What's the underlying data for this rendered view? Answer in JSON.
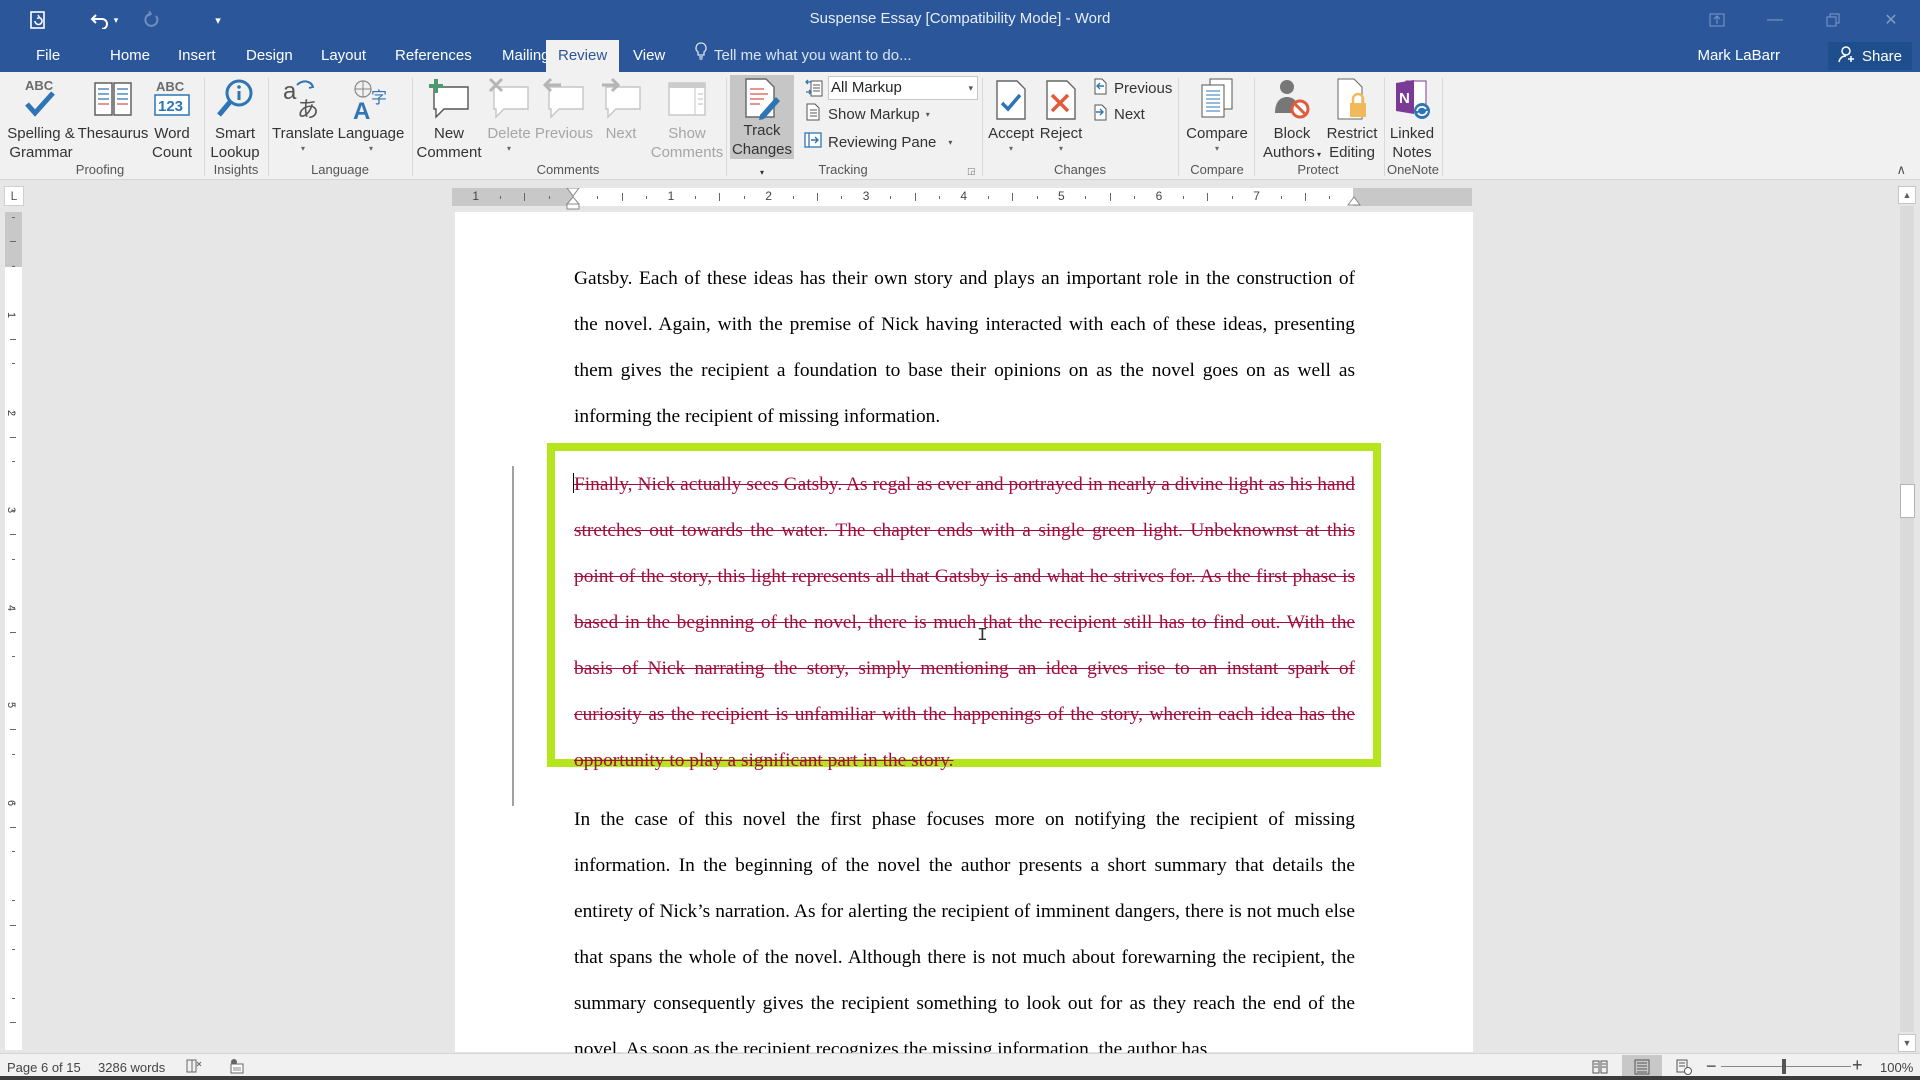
{
  "window": {
    "title": "Suspense Essay [Compatibility Mode] - Word",
    "controls": [
      "ribbon-display-options",
      "minimize",
      "restore",
      "close"
    ]
  },
  "quick_access": {
    "items": [
      {
        "name": "autosave-icon",
        "glyph": "⟳"
      },
      {
        "name": "undo-icon",
        "glyph": "↶"
      },
      {
        "name": "redo-icon",
        "glyph": "↻"
      },
      {
        "name": "customize-qat-icon",
        "glyph": "▾"
      }
    ]
  },
  "tabs": [
    {
      "label": "File",
      "active": false
    },
    {
      "label": "Home",
      "active": false
    },
    {
      "label": "Insert",
      "active": false
    },
    {
      "label": "Design",
      "active": false
    },
    {
      "label": "Layout",
      "active": false
    },
    {
      "label": "References",
      "active": false
    },
    {
      "label": "Mailings",
      "active": false
    },
    {
      "label": "Review",
      "active": true
    },
    {
      "label": "View",
      "active": false
    }
  ],
  "tell_me": {
    "placeholder": "Tell me what you want to do..."
  },
  "user": {
    "name": "Mark LaBarr"
  },
  "share": {
    "label": "Share"
  },
  "ribbon": {
    "groups": {
      "proofing": "Proofing",
      "insights": "Insights",
      "language": "Language",
      "comments": "Comments",
      "tracking": "Tracking",
      "changes": "Changes",
      "compare": "Compare",
      "protect": "Protect",
      "onenote": "OneNote"
    },
    "buttons": {
      "spelling": {
        "line1": "Spelling &",
        "line2": "Grammar"
      },
      "thesaurus": {
        "line1": "Thesaurus",
        "line2": ""
      },
      "word_count": {
        "line1": "Word",
        "line2": "Count"
      },
      "smart_lookup": {
        "line1": "Smart",
        "line2": "Lookup"
      },
      "translate": {
        "line1": "Translate",
        "line2": ""
      },
      "language": {
        "line1": "Language",
        "line2": ""
      },
      "new_comment": {
        "line1": "New",
        "line2": "Comment"
      },
      "delete": {
        "line1": "Delete",
        "line2": ""
      },
      "previous_comment": {
        "line1": "Previous",
        "line2": ""
      },
      "next_comment": {
        "line1": "Next",
        "line2": ""
      },
      "show_comments": {
        "line1": "Show",
        "line2": "Comments"
      },
      "track_changes": {
        "line1": "Track",
        "line2": "Changes"
      },
      "accept": {
        "line1": "Accept",
        "line2": ""
      },
      "reject": {
        "line1": "Reject",
        "line2": ""
      },
      "previous_change": "Previous",
      "next_change": "Next",
      "compare": {
        "line1": "Compare",
        "line2": ""
      },
      "block_authors": {
        "line1": "Block",
        "line2": "Authors"
      },
      "restrict_editing": {
        "line1": "Restrict",
        "line2": "Editing"
      },
      "linked_notes": {
        "line1": "Linked",
        "line2": "Notes"
      }
    },
    "markup_dropdown": {
      "value": "All Markup"
    },
    "show_markup": "Show Markup",
    "reviewing_pane": "Reviewing Pane"
  },
  "ruler": {
    "horizontal_numbers": [
      "1",
      "1",
      "2",
      "3",
      "4",
      "5",
      "6",
      "7"
    ],
    "vertical_numbers": [
      "1",
      "2",
      "3",
      "4",
      "5",
      "6"
    ]
  },
  "document": {
    "paragraph_1": "Gatsby. Each of these ideas has their own story and plays an important role in the construction of the novel. Again, with the premise of Nick having interacted with each of these ideas, presenting them gives the recipient a foundation to base their opinions on as the novel goes on as well as informing the recipient of missing information.",
    "deleted_paragraph": "Finally, Nick actually sees Gatsby. As regal as ever and portrayed in nearly a divine light as his hand stretches out towards the water. The chapter ends with a single green light. Unbeknownst at this point of the story, this light represents all that Gatsby is and what he strives for. As the first phase is based in the beginning of the novel, there is much that the recipient still has to find out. With the basis of Nick narrating the story, simply mentioning an idea gives rise to an instant spark of curiosity as the recipient is unfamiliar with the happenings of the story, wherein each idea has the opportunity to play a significant part in the story.",
    "paragraph_3": "In the case of this novel the first phase focuses more on notifying the recipient of missing information. In the beginning of the novel the author presents a short summary that details the entirety of Nick’s narration. As for alerting the recipient of imminent dangers, there is not much else that spans the whole of the novel. Although there is not much about forewarning the recipient, the summary consequently gives the recipient something to look out for as they reach the end of the novel. As soon as the recipient recognizes the missing information, the author has",
    "deleted_text_color": "#a30d3c",
    "highlight_color": "#b5e61d"
  },
  "status_bar": {
    "page": "Page 6 of 15",
    "words": "3286 words",
    "zoom": "100%",
    "zoom_minus": "−",
    "zoom_plus": "+",
    "active_view": "print-layout"
  },
  "colors": {
    "brand": "#2b579a",
    "ribbon_bg": "#f1f1f1"
  }
}
